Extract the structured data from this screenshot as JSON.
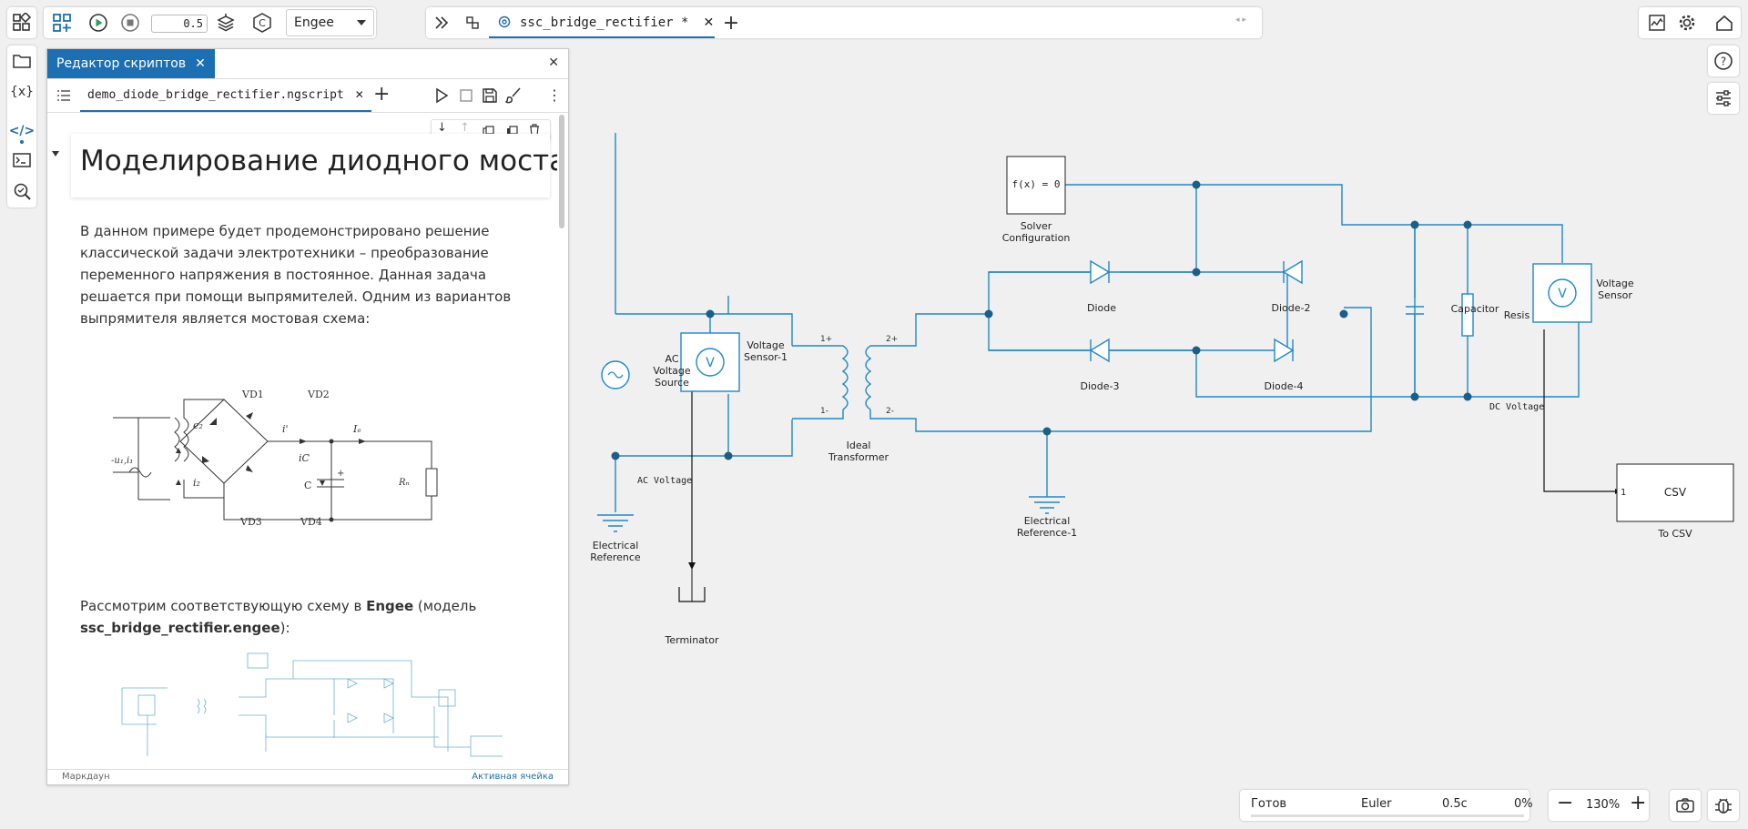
{
  "toolbar": {
    "sim_time": "0.5",
    "solver_select": "Engee",
    "tab_label": "ssc_bridge_rectifier *"
  },
  "editor": {
    "title": "Редактор скриптов",
    "file_tab": "demo_diode_bridge_rectifier.ngscript",
    "heading": "Моделирование диодного моста",
    "para1": "В данном примере будет продемонстрировано решение классической задачи электротехники – преобразование переменного напряжения в постоянное. Данная задача решается при помощи выпрямителей. Одним из вариантов выпрямителя является мостовая схема:",
    "para2_start": "Рассмотрим соответствующую схему в ",
    "para2_bold1": "Engee",
    "para2_mid": " (модель ",
    "para2_bold2": "ssc_bridge_rectifier.engee",
    "para2_end": "):",
    "footer_left": "Маркдаун",
    "footer_right": "Активная ячейка",
    "circuit_labels": {
      "vd1": "VD1",
      "vd2": "VD2",
      "vd3": "VD3",
      "vd4": "VD4",
      "u1": "-u₁,i₁",
      "e2": "e₂",
      "i2": "i₂",
      "i_prime": "i'",
      "id": "Iₑ",
      "ic": "iC",
      "c": "C",
      "rn": "Rₙ",
      "plus": "+"
    }
  },
  "canvas": {
    "solver_block": "f(x) = 0",
    "solver_label": "Solver Configuration",
    "ac_source_label": "AC Voltage Source",
    "vsensor1_label": "Voltage Sensor-1",
    "vsensor_label": "Voltage Sensor",
    "transformer_label": "Ideal Transformer",
    "diode": "Diode",
    "diode2": "Diode-2",
    "diode3": "Diode-3",
    "diode4": "Diode-4",
    "capacitor": "Capacitor",
    "resistor": "Resis",
    "elref": "Electrical Reference",
    "elref1": "Electrical Reference-1",
    "terminator": "Terminator",
    "ac_voltage_signal": "AC Voltage",
    "dc_voltage_signal": "DC Voltage",
    "to_csv_block": "CSV",
    "to_csv_port": "1",
    "to_csv_label": "To CSV",
    "port_1p": "1+",
    "port_1m": "1-",
    "port_2p": "2+",
    "port_2m": "2-"
  },
  "status": {
    "state": "Готов",
    "solver": "Euler",
    "time": "0.5с",
    "progress_pct": "0%",
    "zoom": "130%"
  },
  "colors": {
    "accent": "#1c6fb3",
    "wire": "#1e88c8",
    "node": "#1a5f86"
  }
}
